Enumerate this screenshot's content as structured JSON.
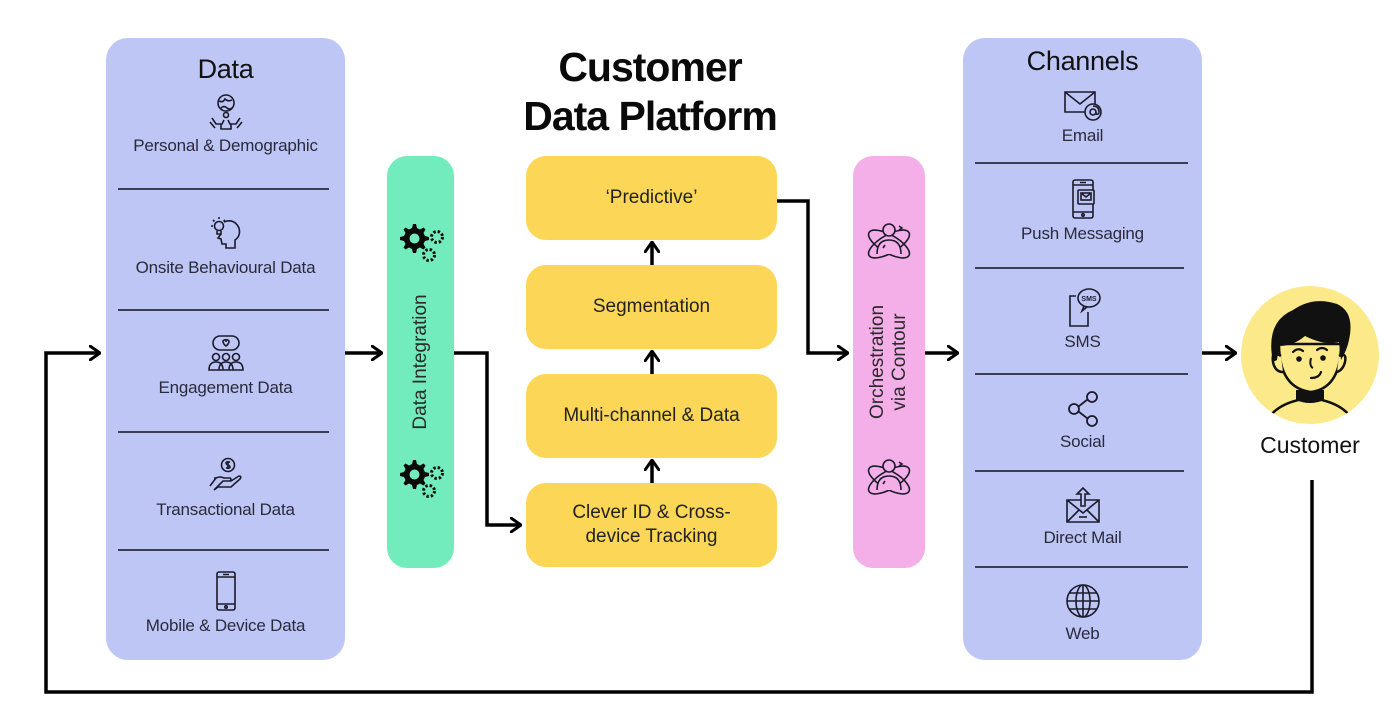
{
  "title": {
    "line1": "Customer",
    "line2": "Data Platform"
  },
  "data_panel": {
    "title": "Data",
    "items": [
      {
        "label": "Personal & Demographic",
        "icon": "globe-hands-icon"
      },
      {
        "label": "Onsite Behavioural Data",
        "icon": "head-lightbulb-icon"
      },
      {
        "label": "Engagement Data",
        "icon": "group-chat-heart-icon"
      },
      {
        "label": "Transactional Data",
        "icon": "hand-coin-icon"
      },
      {
        "label": "Mobile & Device Data",
        "icon": "mobile-phone-icon"
      }
    ]
  },
  "integration": {
    "label": "Data Integration",
    "icon": "gears-icon"
  },
  "platform": {
    "steps": [
      {
        "label": "‘Predictive’"
      },
      {
        "label": "Segmentation"
      },
      {
        "label": "Multi-channel & Data"
      },
      {
        "label": "Clever ID & Cross-device Tracking"
      }
    ]
  },
  "orchestration": {
    "line1": "Orchestration",
    "line2": "via Contour",
    "icon": "person-orbit-icon"
  },
  "channels_panel": {
    "title": "Channels",
    "items": [
      {
        "label": "Email",
        "icon": "email-at-icon"
      },
      {
        "label": "Push Messaging",
        "icon": "phone-message-icon"
      },
      {
        "label": "SMS",
        "icon": "sms-bubble-icon"
      },
      {
        "label": "Social",
        "icon": "share-icon"
      },
      {
        "label": "Direct Mail",
        "icon": "envelope-upload-icon"
      },
      {
        "label": "Web",
        "icon": "globe-icon"
      }
    ]
  },
  "customer": {
    "label": "Customer",
    "icon": "customer-avatar-icon"
  },
  "colors": {
    "panel": "#bec6f6",
    "integration": "#72ecbd",
    "orchestration": "#f4aee8",
    "platform_box": "#fcd656",
    "customer_circle": "#fbe98a",
    "arrow": "#000000"
  }
}
